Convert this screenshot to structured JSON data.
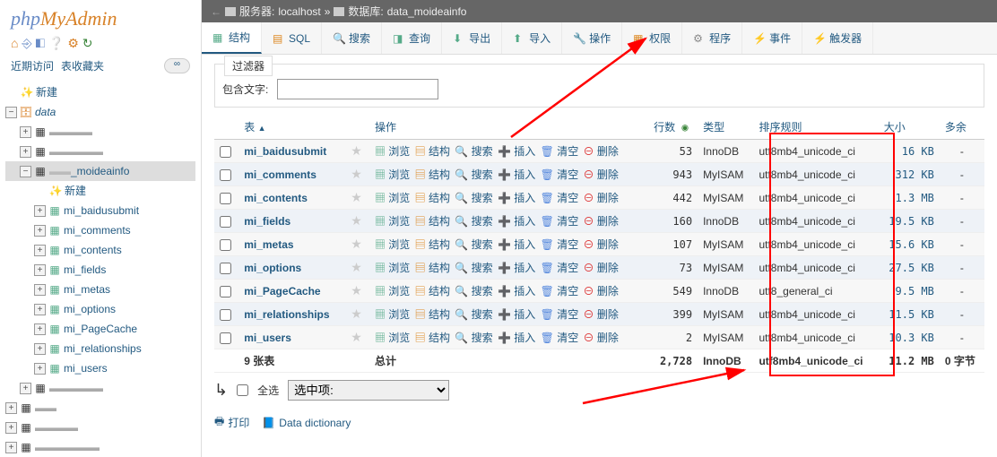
{
  "logo": {
    "p1": "php",
    "p2": "MyAdmin"
  },
  "recent": {
    "tab1": "近期访问",
    "tab2": "表收藏夹"
  },
  "tree": {
    "new": "新建",
    "db": "data",
    "moidea": "_moideainfo",
    "newtable": "新建",
    "tables": [
      "mi_baidusubmit",
      "mi_comments",
      "mi_contents",
      "mi_fields",
      "mi_metas",
      "mi_options",
      "mi_PageCache",
      "mi_relationships",
      "mi_users"
    ]
  },
  "breadcrumb": {
    "server_label": "服务器:",
    "server": "localhost",
    "db_label": "数据库:",
    "db": "data_moideainfo",
    "sep": "»"
  },
  "tabs": [
    "结构",
    "SQL",
    "搜索",
    "查询",
    "导出",
    "导入",
    "操作",
    "权限",
    "程序",
    "事件",
    "触发器"
  ],
  "filter": {
    "legend": "过滤器",
    "label": "包含文字:",
    "value": ""
  },
  "columns": {
    "chk": "",
    "table": "表",
    "sort": "▲",
    "ops": "操作",
    "rows": "行数",
    "type": "类型",
    "collation": "排序规则",
    "size": "大小",
    "overhead": "多余"
  },
  "ops": {
    "browse": "浏览",
    "structure": "结构",
    "search": "搜索",
    "insert": "插入",
    "empty": "清空",
    "drop": "删除"
  },
  "rows": [
    {
      "name": "mi_baidusubmit",
      "rows": "53",
      "type": "InnoDB",
      "coll": "utf8mb4_unicode_ci",
      "size": "16 KB",
      "over": "-"
    },
    {
      "name": "mi_comments",
      "rows": "943",
      "type": "MyISAM",
      "coll": "utf8mb4_unicode_ci",
      "size": "312 KB",
      "over": "-"
    },
    {
      "name": "mi_contents",
      "rows": "442",
      "type": "MyISAM",
      "coll": "utf8mb4_unicode_ci",
      "size": "1.3 MB",
      "over": "-"
    },
    {
      "name": "mi_fields",
      "rows": "160",
      "type": "InnoDB",
      "coll": "utf8mb4_unicode_ci",
      "size": "19.5 KB",
      "over": "-"
    },
    {
      "name": "mi_metas",
      "rows": "107",
      "type": "MyISAM",
      "coll": "utf8mb4_unicode_ci",
      "size": "15.6 KB",
      "over": "-"
    },
    {
      "name": "mi_options",
      "rows": "73",
      "type": "MyISAM",
      "coll": "utf8mb4_unicode_ci",
      "size": "27.5 KB",
      "over": "-"
    },
    {
      "name": "mi_PageCache",
      "rows": "549",
      "type": "InnoDB",
      "coll": "utf8_general_ci",
      "size": "9.5 MB",
      "over": "-"
    },
    {
      "name": "mi_relationships",
      "rows": "399",
      "type": "MyISAM",
      "coll": "utf8mb4_unicode_ci",
      "size": "11.5 KB",
      "over": "-"
    },
    {
      "name": "mi_users",
      "rows": "2",
      "type": "MyISAM",
      "coll": "utf8mb4_unicode_ci",
      "size": "10.3 KB",
      "over": "-"
    }
  ],
  "total": {
    "label": "9 张表",
    "sum": "总计",
    "rows": "2,728",
    "type": "InnoDB",
    "coll": "utf8mb4_unicode_ci",
    "size": "11.2 MB",
    "over": "0 字节"
  },
  "footer": {
    "checkall": "全选",
    "withsel": "选中项:"
  },
  "bottom": {
    "print": "打印",
    "dict": "Data dictionary"
  }
}
